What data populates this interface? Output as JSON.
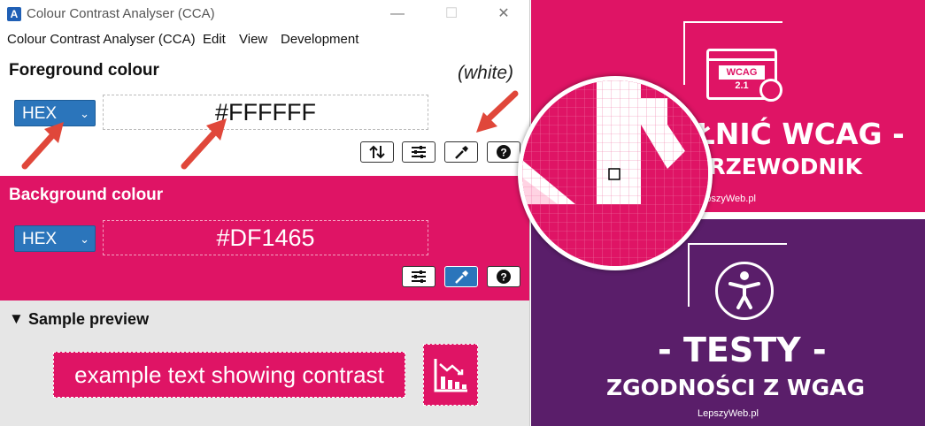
{
  "window": {
    "title": "Colour Contrast Analyser (CCA)",
    "app_icon_letter": "A",
    "minimize": "—",
    "maximize": "☐",
    "close": "✕"
  },
  "menu": [
    "Colour Contrast Analyser (CCA)",
    "Edit",
    "View",
    "Development"
  ],
  "foreground": {
    "title": "Foreground colour",
    "colour_name": "(white)",
    "format": "HEX",
    "value": "#FFFFFF"
  },
  "background": {
    "title": "Background colour",
    "format": "HEX",
    "value": "#DF1465"
  },
  "preview": {
    "title": "Sample preview",
    "toggle": "▼",
    "sample_text": "example text showing contrast"
  },
  "graphic_top": {
    "badge_line1": "WCAG",
    "badge_line2": "2.1",
    "headline1": "EŁNIĆ WCAG -",
    "headline2": "PRZEWODNIK",
    "site": "LepszyWeb.pl"
  },
  "graphic_bottom": {
    "headline1": "- TESTY -",
    "headline2": "ZGODNOŚCI Z WGAG",
    "site": "LepszyWeb.pl"
  },
  "colors": {
    "accent": "#DF1465",
    "purple": "#5a1e6a",
    "select_blue": "#2b75bb",
    "arrow": "#e0473a"
  }
}
